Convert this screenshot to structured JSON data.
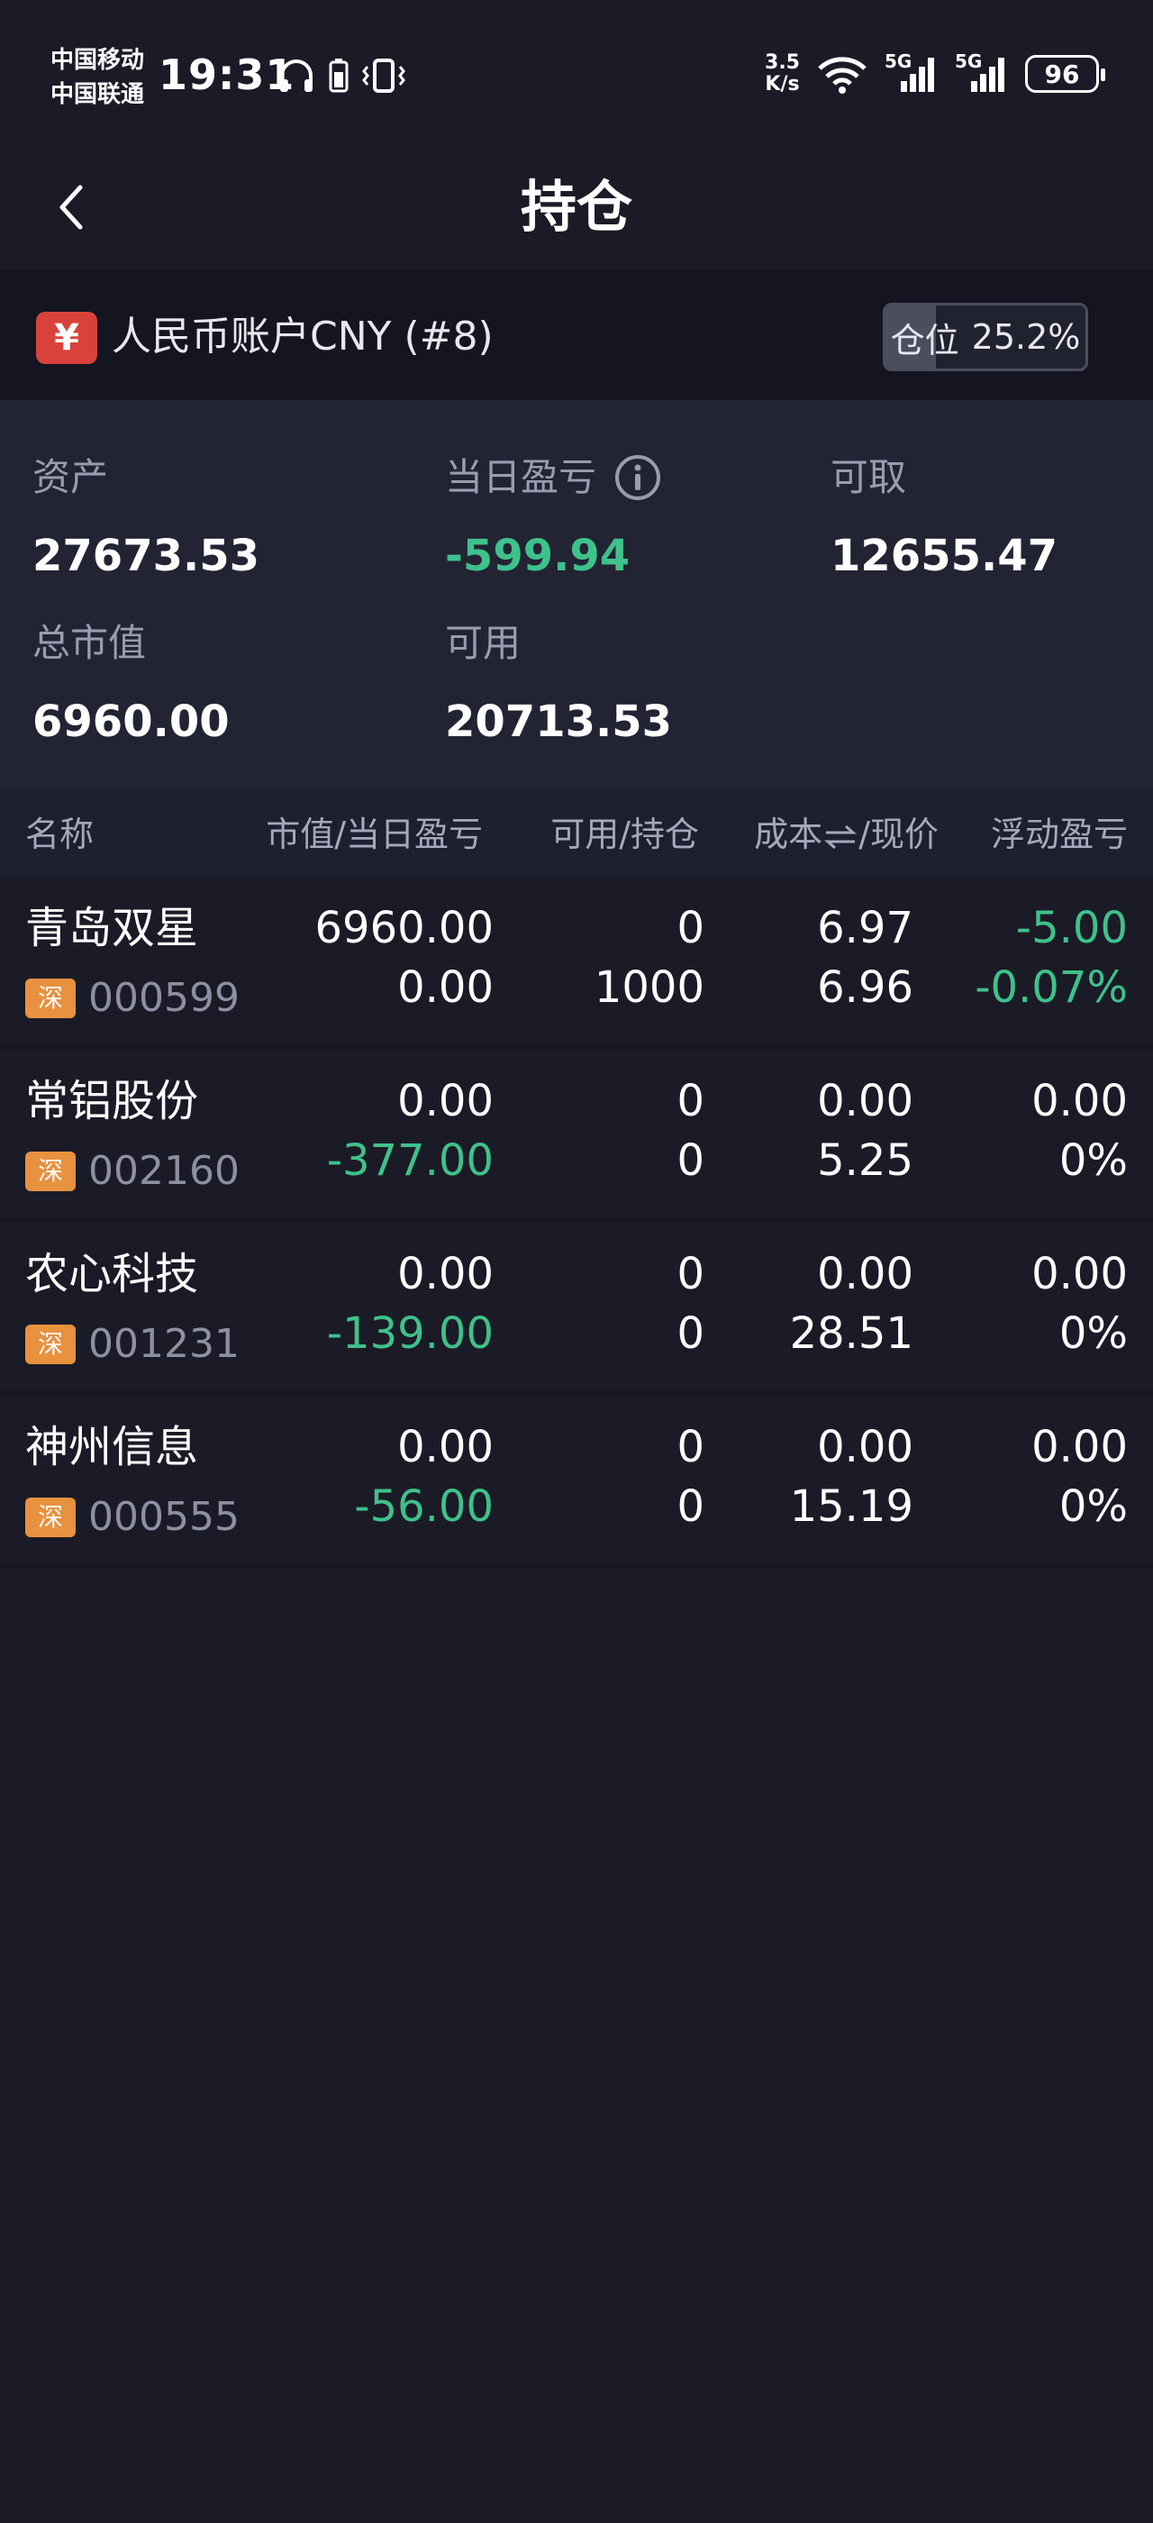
{
  "status_bar": {
    "carrier1": "中国移动",
    "carrier2": "中国联通",
    "time": "19:31",
    "net_speed_value": "3.5",
    "net_speed_unit": "K/s",
    "signal1_label": "5G",
    "signal2_label": "5G",
    "battery": "96"
  },
  "header": {
    "title": "持仓"
  },
  "account": {
    "currency_symbol": "¥",
    "name": "人民币账户CNY (#8)",
    "position_label": "仓位",
    "position_value": "25.2%",
    "position_fraction": 0.252
  },
  "summary": {
    "assets_label": "资产",
    "assets_value": "27673.53",
    "daily_pl_label": "当日盈亏",
    "daily_pl_value": "-599.94",
    "withdrawable_label": "可取",
    "withdrawable_value": "12655.47",
    "market_value_label": "总市值",
    "market_value_value": "6960.00",
    "available_label": "可用",
    "available_value": "20713.53"
  },
  "table": {
    "headers": {
      "name": "名称",
      "value_pl": "市值/当日盈亏",
      "avail_hold": "可用/持仓",
      "cost_prefix": "成本",
      "cost_suffix": "/现价",
      "floating_pl": "浮动盈亏"
    },
    "rows": [
      {
        "name": "青岛双星",
        "market": "深",
        "code": "000599",
        "market_value": "6960.00",
        "daily_pl": "0.00",
        "available": "0",
        "holding": "1000",
        "cost": "6.97",
        "price": "6.96",
        "float_pl": "-5.00",
        "float_pct": "-0.07%"
      },
      {
        "name": "常铝股份",
        "market": "深",
        "code": "002160",
        "market_value": "0.00",
        "daily_pl": "-377.00",
        "available": "0",
        "holding": "0",
        "cost": "0.00",
        "price": "5.25",
        "float_pl": "0.00",
        "float_pct": "0%"
      },
      {
        "name": "农心科技",
        "market": "深",
        "code": "001231",
        "market_value": "0.00",
        "daily_pl": "-139.00",
        "available": "0",
        "holding": "0",
        "cost": "0.00",
        "price": "28.51",
        "float_pl": "0.00",
        "float_pct": "0%"
      },
      {
        "name": "神州信息",
        "market": "深",
        "code": "000555",
        "market_value": "0.00",
        "daily_pl": "-56.00",
        "available": "0",
        "holding": "0",
        "cost": "0.00",
        "price": "15.19",
        "float_pl": "0.00",
        "float_pct": "0%"
      }
    ]
  },
  "colors": {
    "background": "#1a1b27",
    "positive_negative_green": "#3fc18b",
    "badge_red": "#d9423b",
    "market_tag": "#e8913f"
  }
}
